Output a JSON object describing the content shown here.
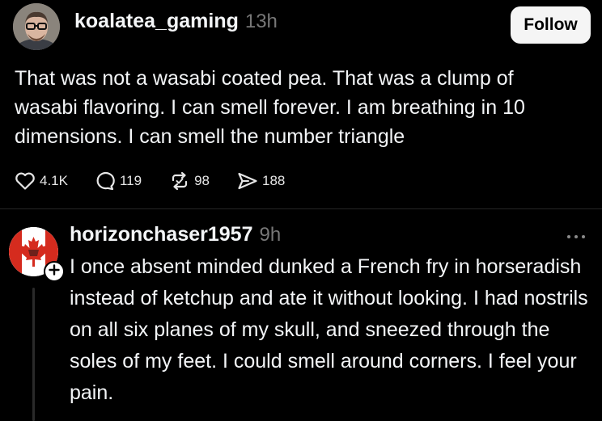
{
  "post": {
    "username": "koalatea_gaming",
    "timestamp": "13h",
    "follow_label": "Follow",
    "text": "That was not a wasabi coated pea. That was a clump of wasabi flavoring. I can smell forever. I am breathing in 10 dimensions. I can smell the number triangle",
    "actions": {
      "likes": "4.1K",
      "replies": "119",
      "reposts": "98",
      "shares": "188"
    },
    "icons": {
      "like": "heart-icon",
      "reply": "comment-icon",
      "repost": "repost-icon",
      "share": "send-icon"
    }
  },
  "reply": {
    "username": "horizonchaser1957",
    "timestamp": "9h",
    "text": "I once absent minded dunked a French fry in horseradish instead of ketchup and ate it without looking. I had nostrils on all six planes of my skull, and sneezed through the soles of my feet. I could smell around corners. I feel your pain.",
    "icons": {
      "add": "plus-icon",
      "more": "more-horizontal-icon"
    }
  },
  "colors": {
    "background": "#000000",
    "primary_text": "#f3f5f7",
    "secondary_text": "#777777",
    "button_bg": "#f5f5f5",
    "divider": "#262626",
    "canada_red": "#d52b1e"
  }
}
